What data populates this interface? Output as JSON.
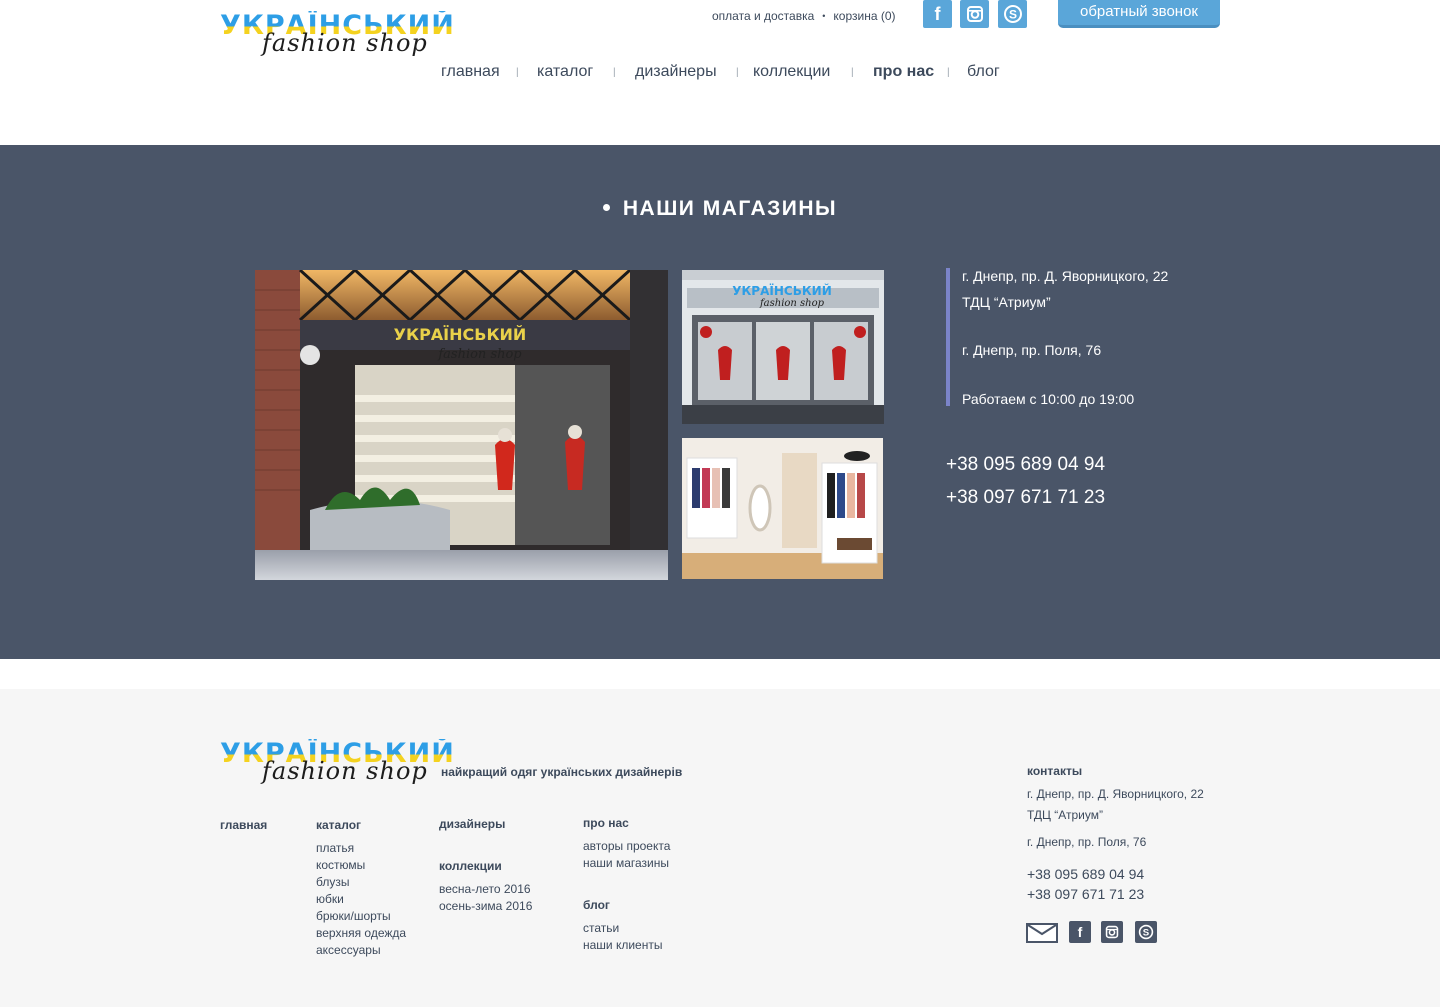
{
  "brand": {
    "logo_top": "УКРАЇНСЬКИЙ",
    "logo_bottom": "fashion shop"
  },
  "top_bar": {
    "delivery": "оплата и доставка",
    "separator": "•",
    "cart": "корзина (0)",
    "callback": "обратный звонок",
    "social": [
      "facebook-icon",
      "instagram-icon",
      "skype-icon"
    ]
  },
  "nav": {
    "items": [
      "главная",
      "каталог",
      "дизайнеры",
      "коллекции",
      "про нас",
      "блог"
    ],
    "active": "про нас",
    "separator": "|"
  },
  "stores": {
    "title": "НАШИ МАГАЗИНЫ",
    "address1_line1": "г. Днепр, пр. Д. Яворницкого, 22",
    "address1_line2": "ТДЦ “Атриум”",
    "address2": "г. Днепр, пр. Поля, 76",
    "hours": "Работаем с 10:00 до 19:00",
    "phone1": "+38 095 689 04 94",
    "phone2": "+38 097 671 71 23",
    "sign_top": "УКРАЇНСЬКИЙ",
    "sign_bottom": "fashion shop"
  },
  "footer": {
    "tagline": "найкращий одяг українських дизайнерів",
    "home": "главная",
    "catalog": {
      "title": "каталог",
      "items": [
        "платья",
        "костюмы",
        "блузы",
        "юбки",
        "брюки/шорты",
        "верхняя одежда",
        "аксессуары"
      ]
    },
    "designers": "дизайнеры",
    "collections": {
      "title": "коллекции",
      "items": [
        "весна-лето 2016",
        "осень-зима 2016"
      ]
    },
    "about": {
      "title": "про нас",
      "items": [
        "авторы проекта",
        "наши магазины"
      ]
    },
    "blog": {
      "title": "блог",
      "items": [
        "статьи",
        "наши клиенты"
      ]
    },
    "contacts": {
      "title": "контакты",
      "address1_line1": "г. Днепр, пр. Д. Яворницкого, 22",
      "address1_line2": "ТДЦ “Атриум”",
      "address2": "г. Днепр, пр. Поля, 76",
      "phone1": "+38 095 689 04 94",
      "phone2": "+38 097 671 71 23",
      "social": [
        "mail-icon",
        "facebook-icon",
        "instagram-icon",
        "skype-icon"
      ]
    }
  },
  "colors": {
    "accent_blue": "#5aa6d9",
    "section_bg": "#4a5568",
    "footer_bg": "#f6f6f6",
    "text": "#3d4a5c",
    "info_border": "#7b84c9",
    "logo_blue": "#2d9ee6",
    "logo_yellow": "#f4d21f"
  }
}
